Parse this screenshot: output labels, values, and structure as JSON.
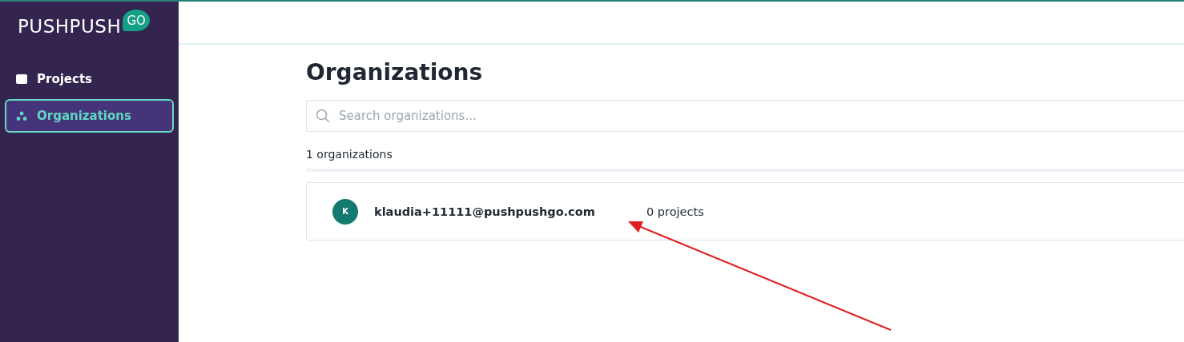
{
  "logo": {
    "text": "PUSHPUSH",
    "badge": "GO"
  },
  "sidebar": {
    "items": [
      {
        "label": "Projects",
        "kind": "window",
        "selected": false
      },
      {
        "label": "Organizations",
        "kind": "dots",
        "selected": true
      }
    ]
  },
  "page": {
    "title": "Organizations",
    "search": {
      "placeholder": "Search organizations..."
    },
    "count": "1 organizations",
    "rows": [
      {
        "avatar": "K",
        "name": "klaudia+11111@pushpushgo.com",
        "projects": "0 projects"
      }
    ]
  },
  "annotation": {
    "kind": "arrow"
  }
}
